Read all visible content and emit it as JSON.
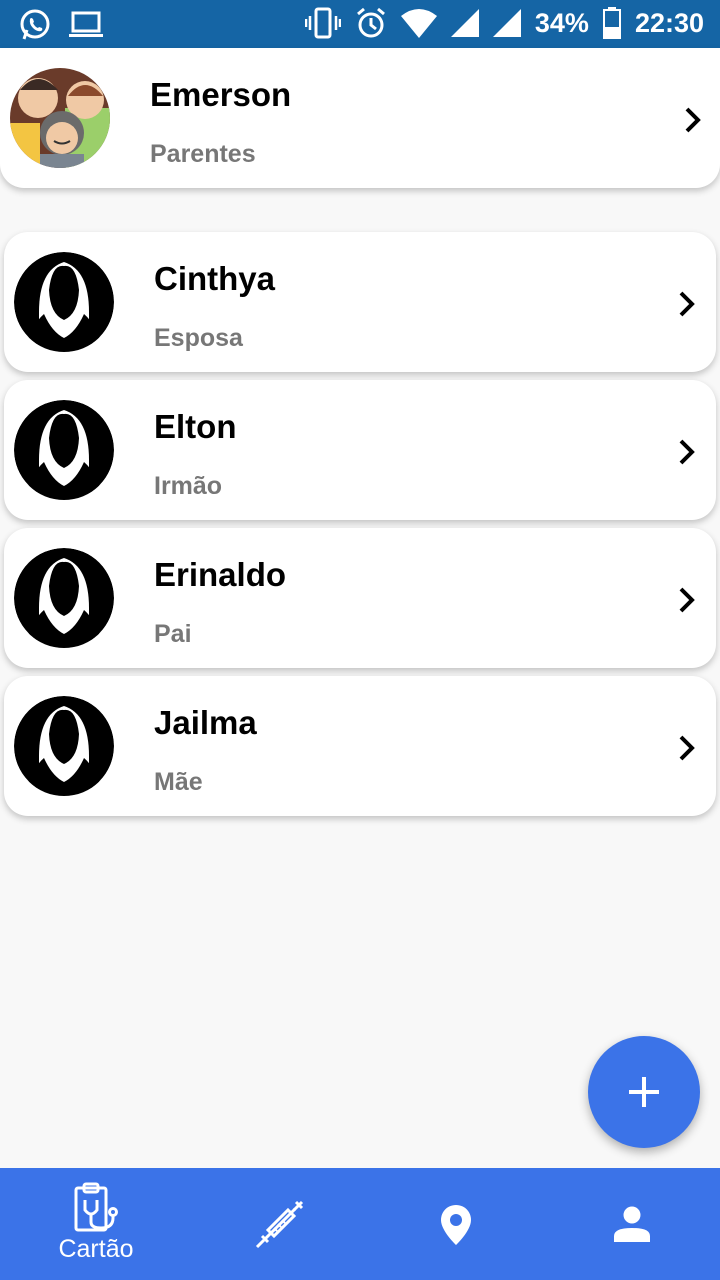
{
  "status_bar": {
    "battery": "34%",
    "time": "22:30"
  },
  "header_card": {
    "name": "Emerson",
    "relation": "Parentes"
  },
  "contacts": [
    {
      "name": "Cinthya",
      "relation": "Esposa"
    },
    {
      "name": "Elton",
      "relation": "Irmão"
    },
    {
      "name": "Erinaldo",
      "relation": "Pai"
    },
    {
      "name": "Jailma",
      "relation": "Mãe"
    }
  ],
  "bottom_nav": {
    "items": [
      {
        "label": "Cartão",
        "icon": "clipboard-stethoscope-icon"
      },
      {
        "label": "",
        "icon": "syringe-icon"
      },
      {
        "label": "",
        "icon": "location-pin-icon"
      },
      {
        "label": "",
        "icon": "person-icon"
      }
    ]
  },
  "colors": {
    "status_bar": "#1565a5",
    "primary": "#3b73e8",
    "background": "#f8f8f8",
    "relation_text": "#777777"
  }
}
